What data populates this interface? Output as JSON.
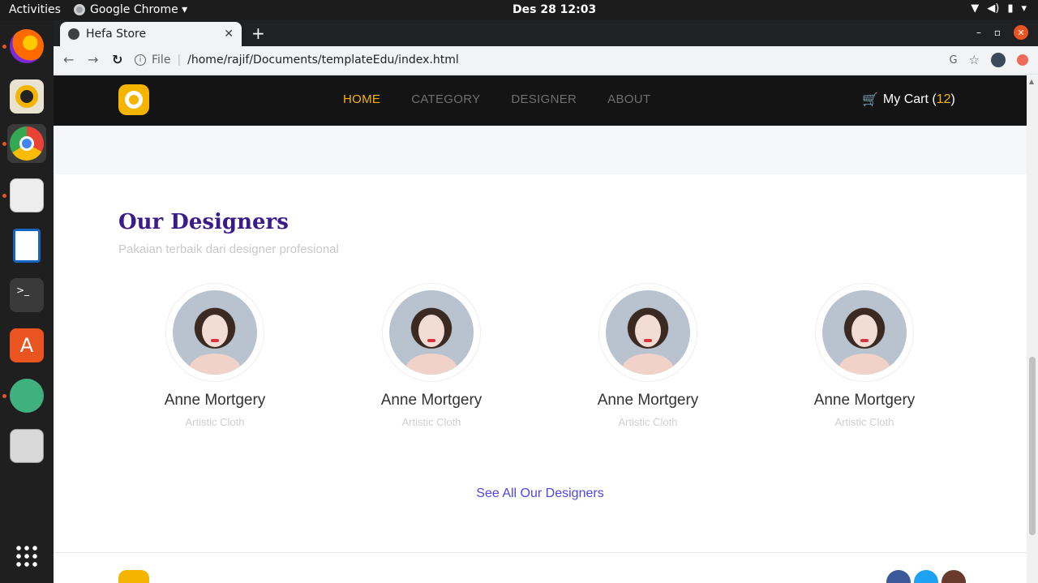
{
  "os": {
    "activities": "Activities",
    "app_menu": "Google Chrome ▾",
    "clock": "Des 28  12:03"
  },
  "browser": {
    "tab_title": "Hefa Store",
    "new_tab": "+",
    "url_scheme": "File",
    "url_path": "/home/rajif/Documents/templateEdu/index.html"
  },
  "site": {
    "nav": {
      "items": [
        {
          "label": "HOME",
          "active": true
        },
        {
          "label": "CATEGORY",
          "active": false
        },
        {
          "label": "DESIGNER",
          "active": false
        },
        {
          "label": "ABOUT",
          "active": false
        }
      ],
      "cart_label": "My Cart (",
      "cart_count": "12",
      "cart_close": ")"
    },
    "designers_section": {
      "title": "Our Designers",
      "subtitle": "Pakaian terbaik dari designer profesional",
      "designers": [
        {
          "name": "Anne Mortgery",
          "role": "Artistic Cloth"
        },
        {
          "name": "Anne Mortgery",
          "role": "Artistic Cloth"
        },
        {
          "name": "Anne Mortgery",
          "role": "Artistic Cloth"
        },
        {
          "name": "Anne Mortgery",
          "role": "Artistic Cloth"
        }
      ],
      "see_all": "See All Our Designers"
    }
  },
  "colors": {
    "brand_yellow": "#f5b400",
    "title_purple": "#3b1a8a",
    "link_blue": "#4f46e5"
  }
}
